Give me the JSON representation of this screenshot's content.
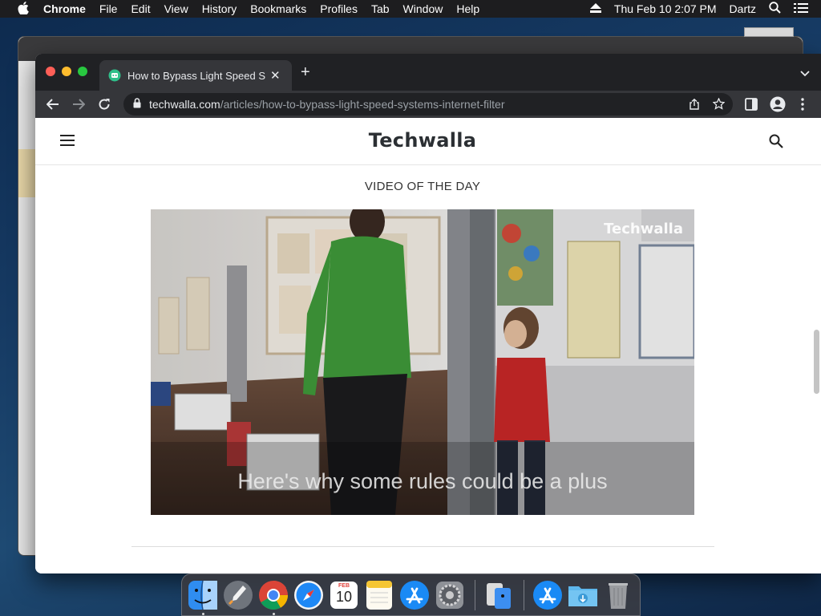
{
  "menubar": {
    "apple_icon": "apple-icon",
    "items": [
      "Chrome",
      "File",
      "Edit",
      "View",
      "History",
      "Bookmarks",
      "Profiles",
      "Tab",
      "Window",
      "Help"
    ],
    "datetime": "Thu Feb 10  2:07 PM",
    "user": "Dartz"
  },
  "browser": {
    "tab_title": "How to Bypass Light Speed Sy",
    "url_host": "techwalla.com",
    "url_path": "/articles/how-to-bypass-light-speed-systems-internet-filter"
  },
  "page": {
    "site_name": "Techwalla",
    "section_heading": "VIDEO OF THE DAY",
    "video": {
      "watermark": "Techwalla",
      "caption": "Here's why some rules could be a plus"
    }
  },
  "dock": {
    "items": [
      "finder-icon",
      "launchpad-icon",
      "chrome-icon",
      "safari-icon",
      "calendar-icon",
      "notes-icon",
      "app-store-icon",
      "system-preferences-icon",
      "migration-assistant-icon",
      "app-store-icon",
      "downloads-folder-icon",
      "trash-icon"
    ],
    "calendar_month": "FEB",
    "calendar_day": "10"
  },
  "colors": {
    "chrome_dark": "#202124",
    "chrome_toolbar": "#35363a",
    "traffic_red": "#ff5f57",
    "traffic_yellow": "#febc2e",
    "traffic_green": "#28c840",
    "logo_text": "#2b2f33"
  }
}
